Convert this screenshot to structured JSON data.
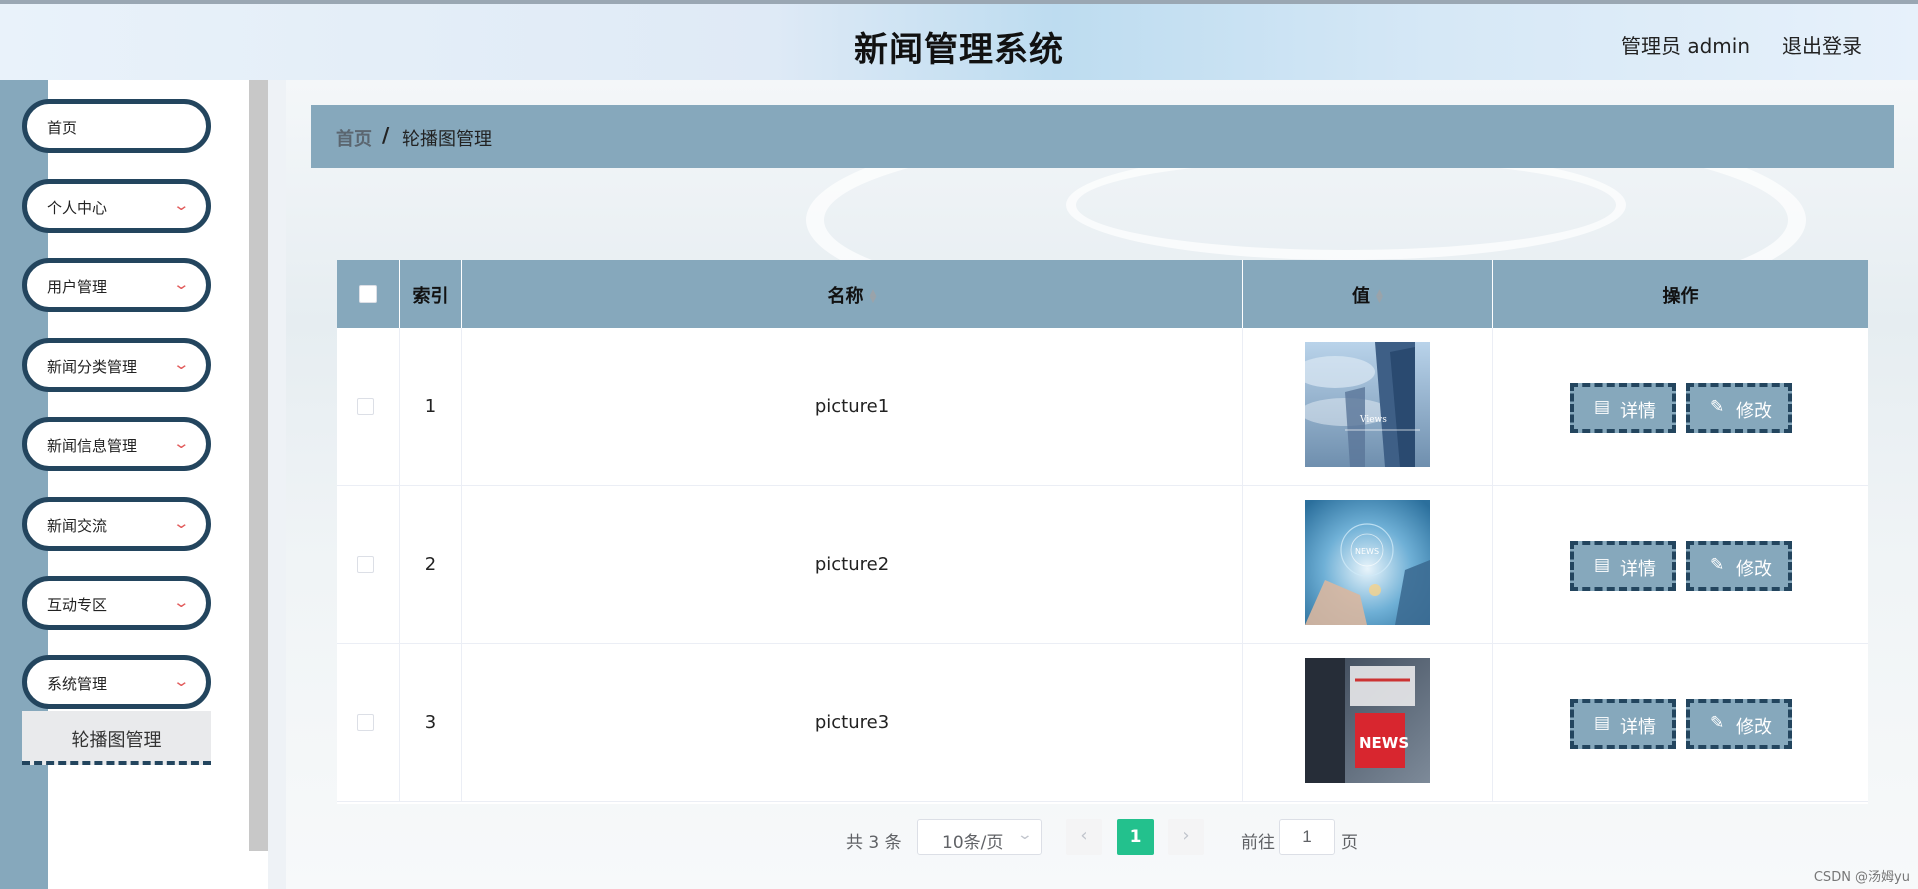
{
  "header": {
    "title": "新闻管理系统",
    "user": "管理员 admin",
    "logout": "退出登录"
  },
  "sidebar": {
    "items": [
      {
        "label": "首页",
        "chevron": false
      },
      {
        "label": "个人中心",
        "chevron": true
      },
      {
        "label": "用户管理",
        "chevron": true
      },
      {
        "label": "新闻分类管理",
        "chevron": true
      },
      {
        "label": "新闻信息管理",
        "chevron": true
      },
      {
        "label": "新闻交流",
        "chevron": true
      },
      {
        "label": "互动专区",
        "chevron": true
      },
      {
        "label": "系统管理",
        "chevron": true
      }
    ],
    "submenu": {
      "label": "轮播图管理"
    }
  },
  "breadcrumb": {
    "home": "首页",
    "separator": "/",
    "current": "轮播图管理"
  },
  "table": {
    "columns": {
      "index": "索引",
      "name": "名称",
      "value": "值",
      "actions": "操作"
    },
    "rows": [
      {
        "index": "1",
        "name": "picture1",
        "thumb_text": "Views"
      },
      {
        "index": "2",
        "name": "picture2",
        "thumb_text": "NEWS"
      },
      {
        "index": "3",
        "name": "picture3",
        "thumb_text": "NEWS"
      }
    ],
    "actions": {
      "detail": "详情",
      "edit": "修改"
    }
  },
  "pagination": {
    "total": "共 3 条",
    "page_size": "10条/页",
    "current_page": "1",
    "goto_label": "前往",
    "goto_value": "1",
    "goto_unit": "页"
  },
  "watermark": "CSDN @汤姆yu",
  "colors": {
    "accent": "#86a8bc",
    "dark": "#23455e",
    "page_active": "#23c18d"
  }
}
